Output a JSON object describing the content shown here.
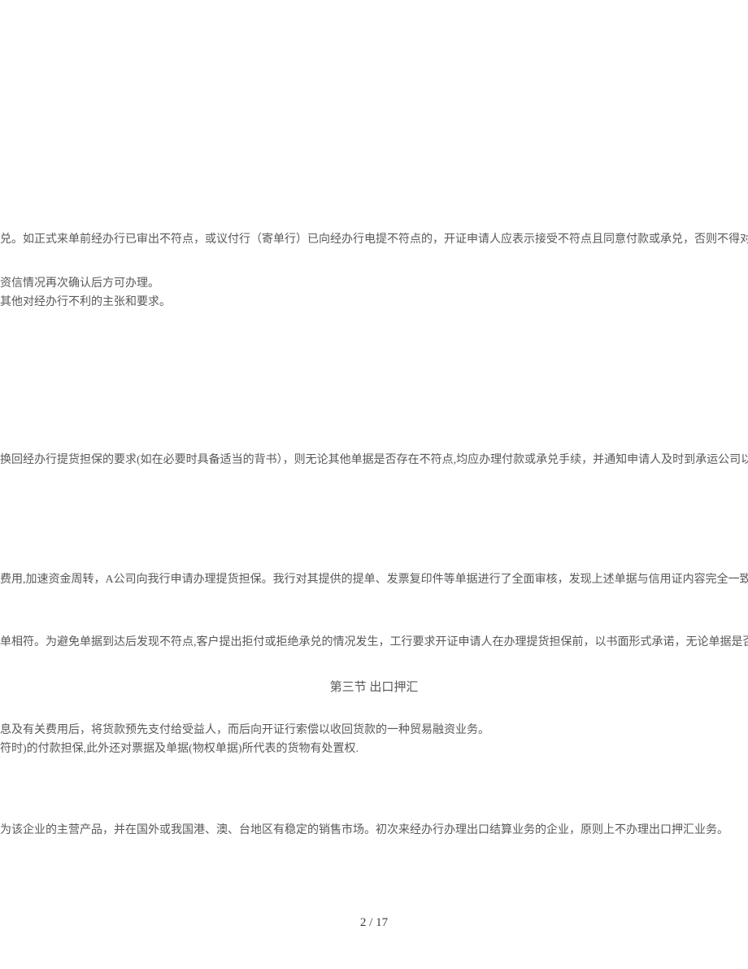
{
  "paragraphs": {
    "p1": "兑。如正式来单前经办行已审出不符点，或议付行（寄单行）已向经办行电提不符点的，开证申请人应表示接受不符点且同意付款或承兑，否则不得对其办",
    "p2": "资信情况再次确认后方可办理。",
    "p3": "其他对经办行不利的主张和要求。",
    "p4": "换回经办行提货担保的要求(如在必要时具备适当的背书），则无论其他单据是否存在不符点,均应办理付款或承兑手续，并通知申请人及时到承运公司以正本",
    "p5": "费用,加速资金周转，A公司向我行申请办理提货担保。我行对其提供的提单、发票复印件等单据进行了全面审核，发现上述单据与信用证内容完全一致,且单",
    "p6": "单相符。为避免单据到达后发现不符点,客户提出拒付或拒绝承兑的情况发生，工行要求开证申请人在办理提货担保前，以书面形式承诺，无论单据是否存在",
    "p7": "息及有关费用后，将货款预先支付给受益人，而后向开证行索偿以收回货款的一种贸易融资业务。",
    "p8": "符时)的付款担保,此外还对票据及单据(物权单据)所代表的货物有处置权.",
    "p9": "为该企业的主营产品，并在国外或我国港、澳、台地区有稳定的销售市场。初次来经办行办理出口结算业务的企业，原则上不办理出口押汇业务。"
  },
  "section_heading": "第三节 出口押汇",
  "page_number": "2 / 17"
}
